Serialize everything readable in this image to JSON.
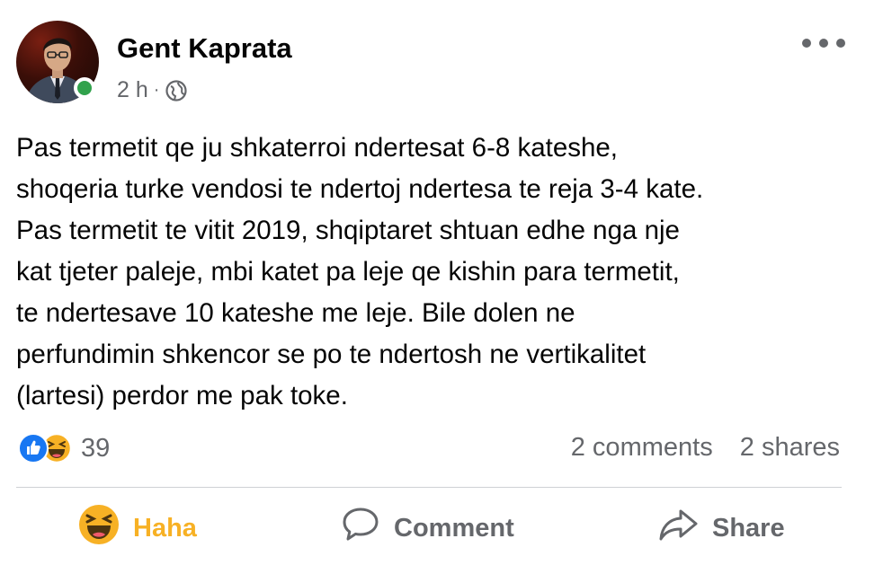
{
  "post": {
    "author": "Gent Kaprata",
    "time": "2 h",
    "separator": "·",
    "audience_icon": "globe-icon",
    "online": true,
    "body_lines": [
      "Pas termetit qe ju shkaterroi ndertesat 6-8 kateshe,",
      "shoqeria turke vendosi te ndertoj ndertesa te reja 3-4 kate.",
      "Pas termetit te vitit 2019, shqiptaret shtuan edhe nga nje",
      "kat tjeter paleje, mbi katet pa leje qe kishin para termetit,",
      "te ndertesave 10 kateshe me leje. Bile dolen ne",
      "perfundimin shkencor se po te ndertosh ne vertikalitet",
      "(lartesi) perdor me pak toke."
    ]
  },
  "reactions": {
    "icons": [
      "like-icon",
      "haha-icon"
    ],
    "count": "39"
  },
  "stats": {
    "comments": "2 comments",
    "shares": "2 shares"
  },
  "actions": {
    "haha": "Haha",
    "comment": "Comment",
    "share": "Share"
  },
  "colors": {
    "brand_blue": "#1877f2",
    "online_green": "#31a24c",
    "haha_yellow": "#f7b125",
    "secondary_text": "#65676b"
  }
}
